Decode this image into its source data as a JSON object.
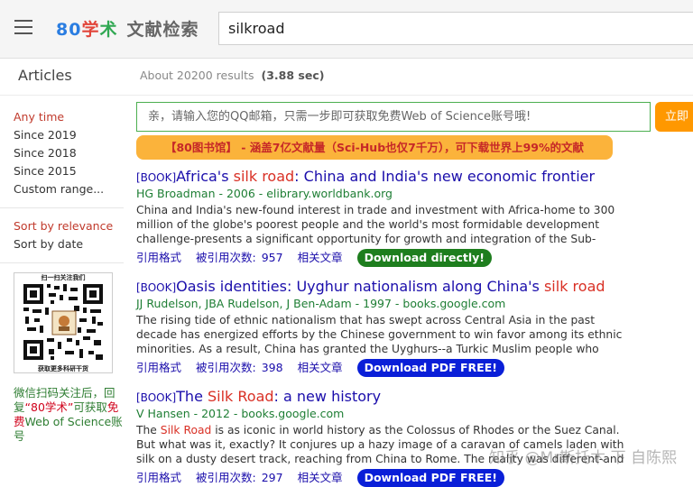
{
  "header": {
    "logo_80": "80",
    "logo_xue": "学",
    "logo_shu": "术",
    "logo_rest": "文献检索",
    "search_value": "silkroad"
  },
  "subbar": {
    "articles_label": "Articles",
    "stats_prefix": "About 20200 results",
    "stats_time": "(3.88 sec)"
  },
  "sidebar": {
    "time_filters": [
      "Any time",
      "Since 2019",
      "Since 2018",
      "Since 2015",
      "Custom range..."
    ],
    "sort_options": [
      "Sort by relevance",
      "Sort by date"
    ],
    "qr_top": "扫一扫关注我们",
    "qr_bottom": "获取更多科研干货",
    "promo_1": "微信扫码关注后，回复",
    "promo_2": "“80学术”",
    "promo_3": "可获取",
    "promo_4": "免费",
    "promo_5": "Web of Science账号"
  },
  "qq": {
    "placeholder": "亲，请输入您的QQ邮箱，只需一步即可获取免费Web of Science账号哦!",
    "button": "立即"
  },
  "banner": "【80图书馆】 - 涵盖7亿文献量（Sci-Hub也仅7千万），可下载世界上99%的文献",
  "results": [
    {
      "tag": "[BOOK]",
      "title_a": "Africa's ",
      "title_hl": "silk road",
      "title_b": ": China and India's new economic frontier",
      "meta": "HG Broadman - 2006 - elibrary.worldbank.org",
      "snippet": "China and India's new-found interest in trade and investment with Africa-home to 300 million of the globe's poorest people and the world's most formidable development challenge-presents a significant opportunity for growth and integration of the Sub-Saharan continent ...",
      "cite": "引用格式",
      "cited": "被引用次数:",
      "cited_count": "957",
      "related": "相关文章",
      "download": "Download directly!"
    },
    {
      "tag": "[BOOK]",
      "title_a": "Oasis identities: Uyghur nationalism along China's ",
      "title_hl": "silk road",
      "title_b": "",
      "meta": "JJ Rudelson, JBA Rudelson, J Ben-Adam - 1997 - books.google.com",
      "snippet": "The rising tide of ethnic nationalism that has swept across Central Asia in the past decade has energized efforts by the Chinese government to win favor among its ethnic minorities. As a result, China has granted the Uyghurs--a Turkic Muslim people who inhabit the oases of ...",
      "cite": "引用格式",
      "cited": "被引用次数:",
      "cited_count": "398",
      "related": "相关文章",
      "download": "Download PDF FREE!"
    },
    {
      "tag": "[BOOK]",
      "title_a": "The ",
      "title_hl": "Silk Road",
      "title_b": ": a new history",
      "meta": "V Hansen - 2012 - books.google.com",
      "snippet_hl": "Silk Road",
      "snippet_a": "The ",
      "snippet_b": " is as iconic in world history as the Colossus of Rhodes or the Suez Canal. But what was it, exactly? It conjures up a hazy image of a caravan of camels laden with silk on a dusty desert track, reaching from China to Rome. The reality was different-and far more ...",
      "cite": "引用格式",
      "cited": "被引用次数:",
      "cited_count": "297",
      "related": "相关文章",
      "download": "Download PDF FREE!"
    }
  ],
  "watermark": "知乎 @Mr斯托木 下 自陈熙"
}
